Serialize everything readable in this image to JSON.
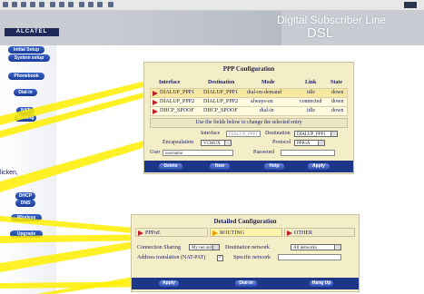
{
  "header": {
    "title": "Digital Subscriber Line",
    "subtitle": "DSL",
    "logo": "ALCATEL"
  },
  "nav": {
    "items": [
      "Initial Setup",
      "System setup",
      "Phonebook",
      "Dial-in",
      "NAT",
      "Routing",
      "DHCP",
      "DNS",
      "Wireless",
      "Upgrade"
    ]
  },
  "callout": {
    "text": "licken,"
  },
  "ppp": {
    "title": "PPP Configuration",
    "columns": [
      "Interface",
      "Destination",
      "Mode",
      "Link",
      "State"
    ],
    "rows": [
      {
        "interface": "DIALUP_PPP1",
        "destination": "DIALUP_PPP1",
        "mode": "dial-on-demand",
        "link": "idle",
        "state": "down"
      },
      {
        "interface": "DIALUP_PPP2",
        "destination": "DIALUP_PPP2",
        "mode": "always-on",
        "link": "connected",
        "state": "down"
      },
      {
        "interface": "DHCP_SPOOF",
        "destination": "DHCP_SPOOF",
        "mode": "dial-in",
        "link": "idle",
        "state": "down"
      }
    ],
    "hint": "Use the fields below to change the selected entry",
    "interface_label": "Interface",
    "interface_value": "DIALUP_PPP1",
    "destination_label": "Destination",
    "destination_value": "DIALUP_PPP1",
    "encapsulation_label": "Encapsulation",
    "encapsulation_value": "VCMUX",
    "protocol_label": "Protocol",
    "protocol_value": "PPPoA",
    "user_label": "User",
    "user_value": "username",
    "password_label": "Password",
    "buttons": [
      "Delete",
      "New",
      "Help",
      "Apply"
    ]
  },
  "detail": {
    "title": "Detailed Configuration",
    "tabs": [
      "PPPoE",
      "ROUTING",
      "OTHER"
    ],
    "active_tab": "ROUTING",
    "sharing_label": "Connection Sharing",
    "sharing_value": "My net only",
    "dest_net_label": "Destination network",
    "dest_net_value": "All networks",
    "nat_label": "Address translation (NAT-PAT)",
    "nat_checked": true,
    "specific_label": "Specific network",
    "buttons": [
      "Apply",
      "Dial-in",
      "Hang Up"
    ]
  },
  "colors": {
    "nav_button": "#1a3c9a",
    "panel": "#f4eec8",
    "button_bar": "#1e3688",
    "callout": "#ffee00",
    "arrow": "#c0202c"
  }
}
